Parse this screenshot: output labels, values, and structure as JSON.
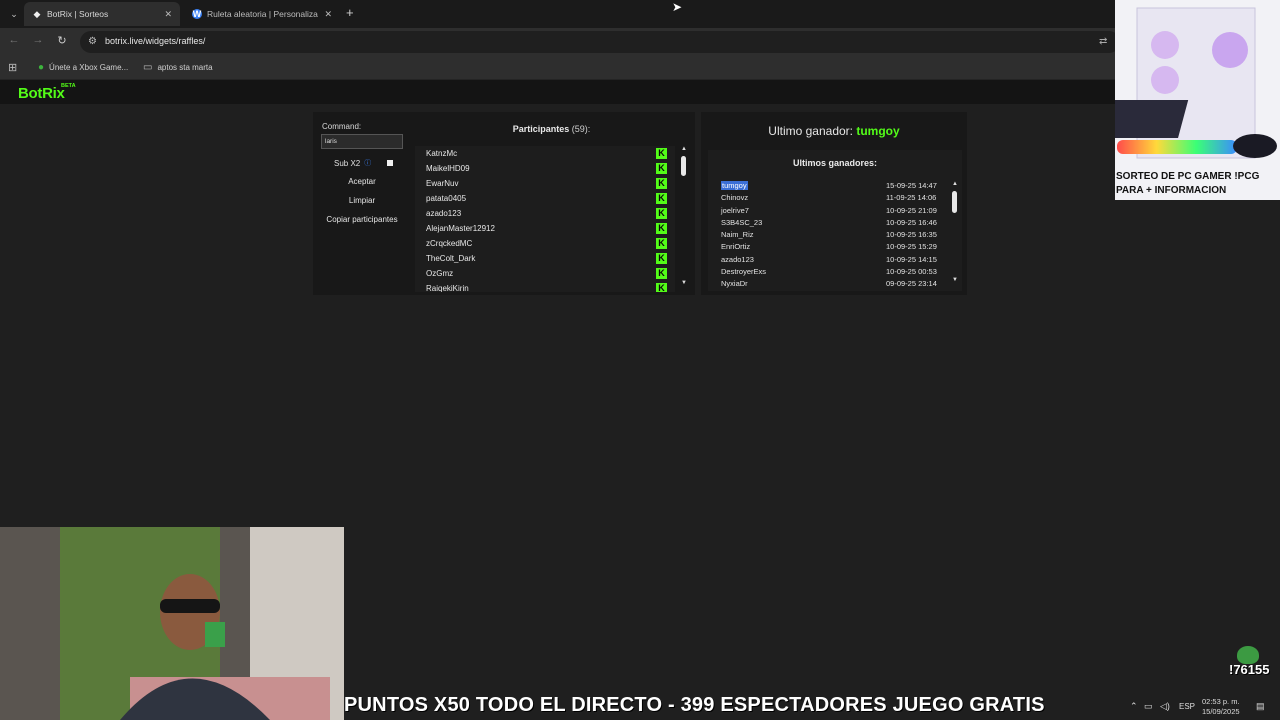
{
  "browser": {
    "tabs": [
      {
        "title": "BotRix | Sorteos",
        "active": true
      },
      {
        "title": "Ruleta aleatoria | Personaliza y ...",
        "active": false
      }
    ],
    "url": "botrix.live/widgets/raffles/",
    "bookmarks": [
      {
        "label": "Únete a Xbox Game...",
        "icon": "xbox-icon"
      },
      {
        "label": "aptos sta marta",
        "icon": "folder-icon"
      }
    ]
  },
  "site": {
    "logo": "BotRix",
    "badge": "BETA"
  },
  "raffle": {
    "command_label": "Command:",
    "command_value": "laris",
    "sub_label": "Sub X2",
    "buttons": {
      "accept": "Aceptar",
      "clear": "Limpiar",
      "copy": "Copiar participantes"
    },
    "participants_title": "Participantes",
    "participants_count": "(59):",
    "participants": [
      "KatnzMc",
      "MaikelHD09",
      "EwarNuv",
      "patata0405",
      "azado123",
      "AlejanMaster12912",
      "zCrqckedMC",
      "TheColt_Dark",
      "OzGmz",
      "RaiqekiKirin"
    ],
    "last_winner_label": "Ultimo ganador:",
    "last_winner": "tumgoy",
    "winners_title": "Ultimos ganadores:",
    "winners": [
      {
        "name": "tumgoy",
        "date": "15-09-25 14:47"
      },
      {
        "name": "Chinovz",
        "date": "11-09-25 14:06"
      },
      {
        "name": "joelrive7",
        "date": "10-09-25 21:09"
      },
      {
        "name": "S3B4SC_23",
        "date": "10-09-25 16:46"
      },
      {
        "name": "Naim_Riz",
        "date": "10-09-25 16:35"
      },
      {
        "name": "EnriOrtiz",
        "date": "10-09-25 15:29"
      },
      {
        "name": "azado123",
        "date": "10-09-25 14:15"
      },
      {
        "name": "DestroyerExs",
        "date": "10-09-25 00:53"
      },
      {
        "name": "NyxiaDr",
        "date": "09-09-25 23:14"
      }
    ]
  },
  "overlay": {
    "promo": "SORTEO DE PC GAMER !PCG PARA + INFORMACION",
    "ticker": "PUNTOS X50 TODO EL DIRECTO - 399 ESPECTADORES JUEGO GRATIS",
    "viewer_count": "!76155"
  },
  "taskbar": {
    "lang": "ESP",
    "time": "02:53 p. m.",
    "date": "15/09/2025"
  },
  "colors": {
    "accent": "#53fc18",
    "selection": "#3b6fd6",
    "background": "#1f1f1f"
  }
}
